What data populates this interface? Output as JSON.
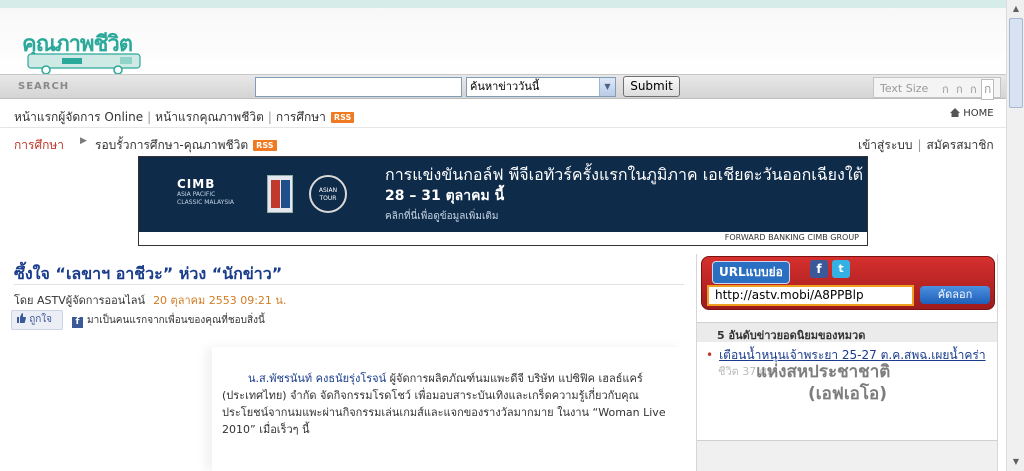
{
  "site": {
    "logo_text": "คุณภาพชีวิต"
  },
  "search": {
    "label": "SEARCH",
    "input_value": "",
    "select_value": "ค้นหาข่าววันนี้",
    "submit_label": "Submit",
    "textsize_label": "Text Size",
    "size_glyphs": [
      "ก",
      "ก",
      "ก",
      "ก"
    ]
  },
  "nav": {
    "links": [
      "หน้าแรกผู้จัดการ Online",
      "หน้าแรกคุณภาพชีวิต",
      "การศึกษา"
    ],
    "rss_label": "RSS",
    "home_label": "HOME",
    "current_section": "การศึกษา",
    "crumb": "รอบรั้วการศึกษา-คุณภาพชีวิต",
    "login": "เข้าสู่ระบบ",
    "register": "สมัครสมาชิก"
  },
  "banner": {
    "brand": "CIMB",
    "brand_sub": "ASIA PACIFIC CLASSIC MALAYSIA",
    "tour": "ASIAN TOUR",
    "headline": "การแข่งขันกอล์ฟ พีจีเอทัวร์ครั้งแรกในภูมิภาค เอเชียตะวันออกเฉียงใต้",
    "dates": "28 – 31 ตุลาคม นี้",
    "cta": "คลิกที่นี่เพื่อดูข้อมูลเพิ่มเติม",
    "footer": "FORWARD BANKING  CIMB GROUP"
  },
  "article": {
    "title": "ซึ้งใจ “เลขาฯ อาชีวะ” ห่วง “นักข่าว”",
    "byline": "โดย ASTVผู้จัดการออนไลน์",
    "date": "20 ตุลาคม 2553 09:21 น.",
    "like_label": "ถูกใจ",
    "fb_text": "มาเป็นคนแรกจากเพื่อนของคุณที่ชอบสิ่งนี้",
    "lead_name": "น.ส.พัชรนันท์ คงธนัยรุ่งโรจน์",
    "lead_body": " ผู้จัดการผลิตภัณฑ์นมแพะดีจี บริษัท แปซิฟิค เฮลธ์แคร์ (ประเทศไทย) จำกัด จัดกิจกรรมโรดโชว์ เพื่อมอบสาระบันเทิงและเกร็ดความรู้เกี่ยวกับคุณประโยชน์จากนมแพะผ่านกิจกรรมเล่นเกมส์และแจกของรางวัลมากมาย ในงาน “Woman Live 2010” เมื่อเร็วๆ นี้"
  },
  "sidebar": {
    "url_badge": "URLแบบย่อ",
    "facebook_glyph": "f",
    "twitter_glyph": "t",
    "short_url": "http://astv.mobi/A8PPBlp",
    "copy_label": "คัดลอก",
    "popular_heading": "5 อันดับข่าวยอดนิยมของหมวด",
    "popular_item": "เตือนน้ำหนุนเจ้าพระยา 25-27 ต.ค.สพฉ.เผยน้ำคร่า",
    "popular_sub": "ชีวิต 37 ศพ",
    "watermark_line1": "แห่งสหประชาชาติ",
    "watermark_line2": "(เอฟเอโอ)"
  },
  "colors": {
    "accent_blue": "#1a3c8c",
    "rss_orange": "#f07a21",
    "section_red": "#c0392b",
    "date_orange": "#d27c22",
    "logo_teal": "#2aa89a"
  }
}
